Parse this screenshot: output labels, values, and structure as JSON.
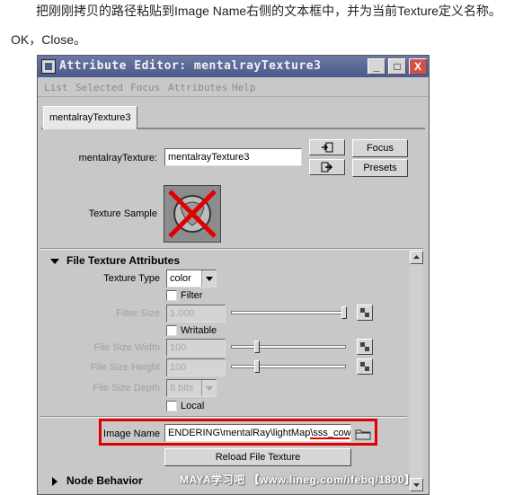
{
  "article": {
    "caption_top": "把刚刚拷贝的路径粘贴到Image Name右侧的文本框中，并为当前Texture定义名称。",
    "caption_ok": "OK，Close。"
  },
  "window": {
    "title": "Attribute Editor: mentalrayTexture3",
    "controls": {
      "minimize": "_",
      "maximize": "□",
      "close": "X"
    }
  },
  "menu": [
    "List",
    "Selected",
    "Focus",
    "Attributes",
    "Help"
  ],
  "tab": {
    "label": "mentalrayTexture3"
  },
  "node": {
    "label": "mentalrayTexture:",
    "value": "mentalrayTexture3",
    "focus_label": "Focus",
    "presets_label": "Presets",
    "texture_sample_label": "Texture Sample"
  },
  "file_texture": {
    "section_label": "File Texture Attributes",
    "texture_type_label": "Texture Type",
    "texture_type_value": "color",
    "filter_label": "Filter",
    "filter_size_label": "Filter Size",
    "filter_size_value": "1.000",
    "writable_label": "Writable",
    "file_size_width_label": "File Size Width",
    "file_size_width_value": "100",
    "file_size_height_label": "File Size Height",
    "file_size_height_value": "100",
    "file_size_depth_label": "File Size Depth",
    "file_size_depth_value": "8 bits",
    "local_label": "Local",
    "image_name_label": "Image Name",
    "image_name_value": "ENDERING\\mentalRay\\lightMap\\sss_cow",
    "reload_label": "Reload File Texture"
  },
  "node_behavior": {
    "section_label": "Node Behavior"
  },
  "watermark": {
    "text": "MAYA学习吧 【www.lineg.com/ifebq/1800】"
  },
  "colors": {
    "titlebar": "#4a5a8a",
    "highlight": "#e00000",
    "panel": "#c8c8c8"
  }
}
